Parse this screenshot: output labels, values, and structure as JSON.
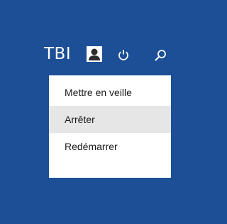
{
  "user": {
    "name": "TBI"
  },
  "icons": {
    "avatar": "user-avatar-icon",
    "power": "power-icon",
    "search": "search-icon"
  },
  "power_menu": {
    "items": [
      {
        "label": "Mettre en veille"
      },
      {
        "label": "Arrêter"
      },
      {
        "label": "Redémarrer"
      }
    ]
  },
  "colors": {
    "background": "#1c4f96",
    "menu": "#ffffff",
    "hover": "#e6e6e6"
  }
}
